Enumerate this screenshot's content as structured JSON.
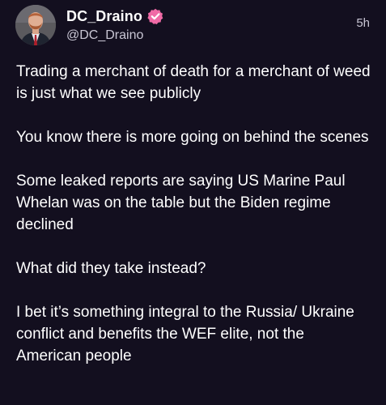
{
  "post": {
    "author": {
      "display_name": "DC_Draino",
      "handle": "@DC_Draino",
      "verified_icon": "verified-badge-icon",
      "verified_color": "#f06aa6",
      "avatar_icon": "user-avatar"
    },
    "timestamp": "5h",
    "paragraphs": [
      "Trading a merchant of death for a merchant of weed is just what we see publicly",
      "You know there is more going on behind the scenes",
      "Some leaked reports are saying US Marine Paul Whelan was on the table but the Biden regime declined",
      "What did they take instead?",
      "I bet it’s something integral to the Russia/ Ukraine conflict and benefits the WEF elite, not the American people"
    ]
  },
  "colors": {
    "background": "#130f1f",
    "text": "#ffffff",
    "secondary_text": "#c9c6d4"
  }
}
